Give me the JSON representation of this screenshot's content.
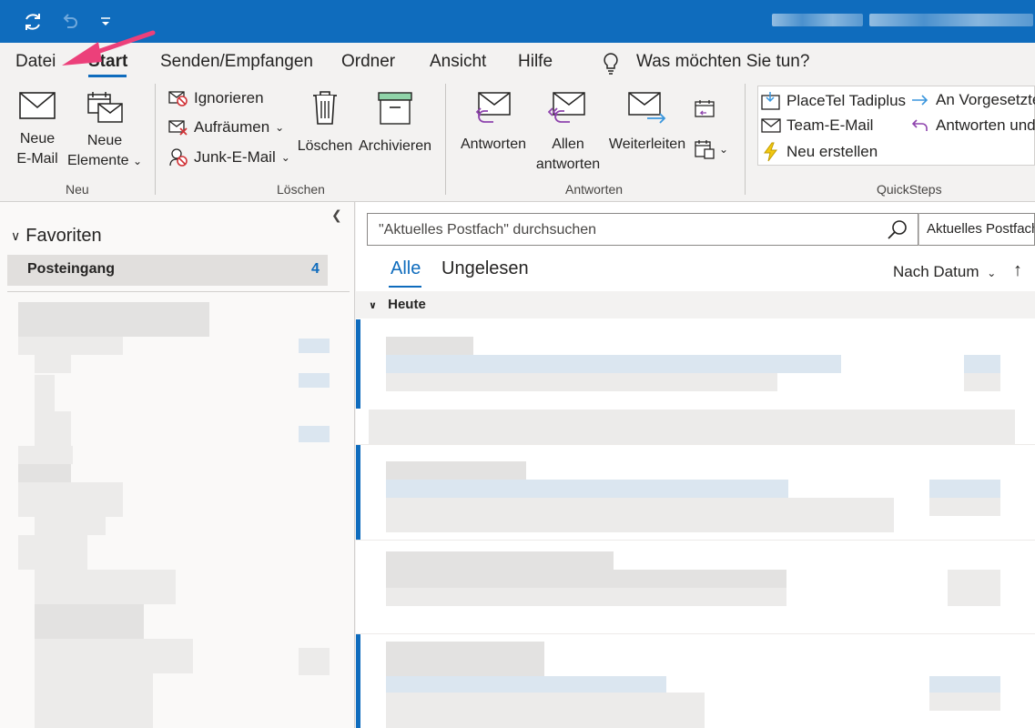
{
  "menu": {
    "tabs": [
      "Datei",
      "Start",
      "Senden/Empfangen",
      "Ordner",
      "Ansicht",
      "Hilfe"
    ],
    "tell_me": "Was möchten Sie tun?"
  },
  "ribbon": {
    "neu": {
      "new_email": [
        "Neue",
        "E-Mail"
      ],
      "new_items": [
        "Neue",
        "Elemente"
      ],
      "label": "Neu"
    },
    "loeschen": {
      "ignore": "Ignorieren",
      "cleanup": "Aufräumen",
      "junk": "Junk-E-Mail",
      "delete": "Löschen",
      "archive": "Archivieren",
      "label": "Löschen"
    },
    "antworten": {
      "reply": "Antworten",
      "reply_all": [
        "Allen",
        "antworten"
      ],
      "forward": "Weiterleiten",
      "label": "Antworten"
    },
    "quicksteps": {
      "items": [
        "PlaceTel Tadiplus",
        "Team-E-Mail",
        "Neu erstellen"
      ],
      "items_right": [
        "An Vorgesetzte",
        "Antworten und"
      ],
      "label": "QuickSteps"
    }
  },
  "folders": {
    "favorites": "Favoriten",
    "inbox": "Posteingang",
    "inbox_count": "4"
  },
  "maillist": {
    "search_placeholder": "\"Aktuelles Postfach\" durchsuchen",
    "scope": "Aktuelles Postfach",
    "filter_all": "Alle",
    "filter_unread": "Ungelesen",
    "sort": "Nach Datum",
    "group_today": "Heute"
  },
  "colors": {
    "accent": "#0f6cbd",
    "arrow": "#ec407a"
  }
}
